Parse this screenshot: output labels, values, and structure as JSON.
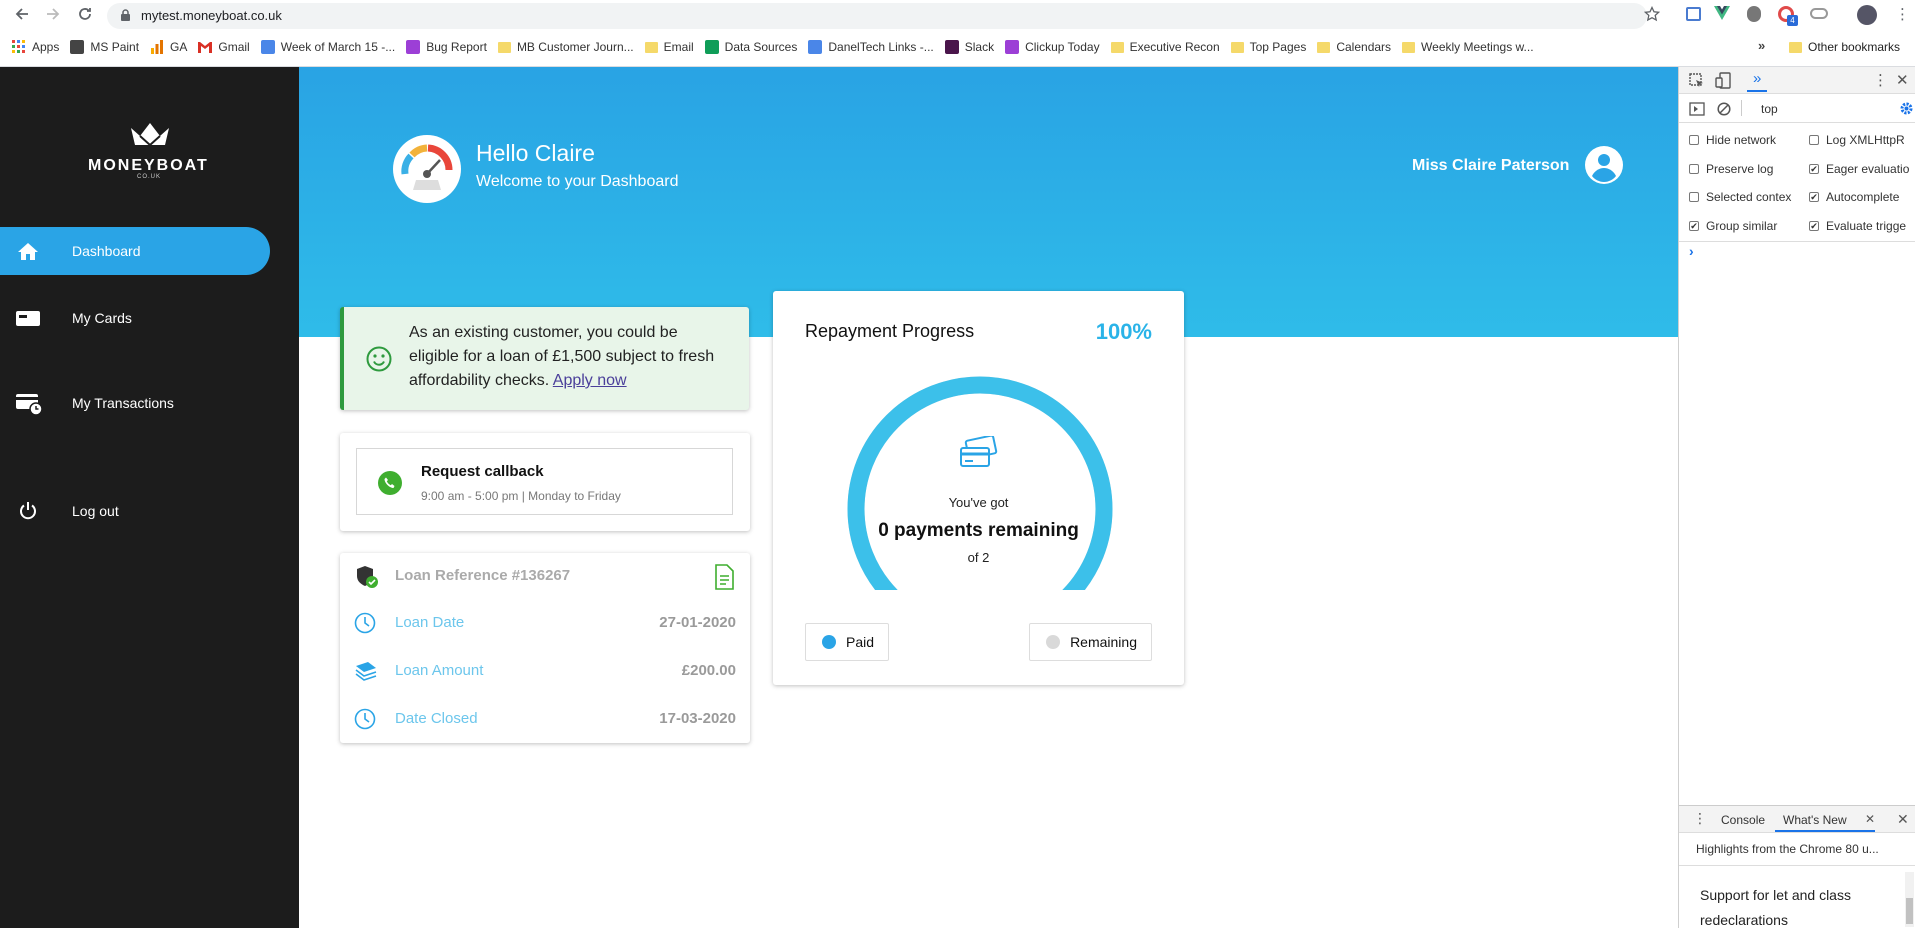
{
  "browser": {
    "url": "mytest.moneyboat.co.uk",
    "bookmarks": [
      {
        "label": "Apps"
      },
      {
        "label": "MS Paint"
      },
      {
        "label": "GA"
      },
      {
        "label": "Gmail"
      },
      {
        "label": "Week of March 15 -..."
      },
      {
        "label": "Bug Report"
      },
      {
        "label": "MB Customer Journ..."
      },
      {
        "label": "Email"
      },
      {
        "label": "Data Sources"
      },
      {
        "label": "DanelTech Links -..."
      },
      {
        "label": "Slack"
      },
      {
        "label": "Clickup Today"
      },
      {
        "label": "Executive Recon"
      },
      {
        "label": "Top Pages"
      },
      {
        "label": "Calendars"
      },
      {
        "label": "Weekly Meetings w..."
      }
    ],
    "more_bookmarks": "»",
    "other_bookmarks": "Other bookmarks"
  },
  "sidebar": {
    "logo": "MONEYBOAT",
    "logo_sub": "CO.UK",
    "items": [
      {
        "label": "Dashboard",
        "icon": "home-icon",
        "active": true
      },
      {
        "label": "My Cards",
        "icon": "card-icon",
        "active": false
      },
      {
        "label": "My Transactions",
        "icon": "transactions-icon",
        "active": false
      },
      {
        "label": "Log out",
        "icon": "power-icon",
        "active": false
      }
    ]
  },
  "header": {
    "greeting": "Hello Claire",
    "subtitle": "Welcome to your Dashboard",
    "user_name": "Miss Claire Paterson"
  },
  "offer": {
    "text": "As an existing customer, you could be eligible for a loan of £1,500 subject to fresh affordability checks.",
    "link": "Apply now"
  },
  "callback": {
    "title": "Request callback",
    "hours": "9:00 am - 5:00 pm | Monday to Friday"
  },
  "loan": {
    "reference": "Loan Reference #136267",
    "rows": [
      {
        "label": "Loan Date",
        "value": "27-01-2020"
      },
      {
        "label": "Loan Amount",
        "value": "£200.00"
      },
      {
        "label": "Date Closed",
        "value": "17-03-2020"
      }
    ]
  },
  "progress": {
    "title": "Repayment Progress",
    "percent": "100%",
    "percent_value": 1.0,
    "got_label": "You've got",
    "remaining_label": "0 payments remaining",
    "of_total": "of 2",
    "legend": {
      "paid": "Paid",
      "remaining": "Remaining"
    }
  },
  "devtools": {
    "context": "top",
    "checkboxes": [
      {
        "label": "Hide network",
        "checked": false
      },
      {
        "label": "Log XMLHttpR",
        "checked": false
      },
      {
        "label": "Preserve log",
        "checked": false
      },
      {
        "label": "Eager evaluatio",
        "checked": true
      },
      {
        "label": "Selected contex",
        "checked": false
      },
      {
        "label": "Autocomplete",
        "checked": true
      },
      {
        "label": "Group similar",
        "checked": true
      },
      {
        "label": "Evaluate trigge",
        "checked": true
      }
    ],
    "prompt": "›",
    "tabs": {
      "console": "Console",
      "whats_new": "What's New"
    },
    "highlights": "Highlights from the Chrome 80 u...",
    "whats_new_text": "Support for let and class redeclarations"
  },
  "colors": {
    "accent": "#2aa4e6",
    "paid": "#2aa4e6",
    "remaining": "#d9d9d9",
    "offer_green": "#2e9a3e"
  }
}
